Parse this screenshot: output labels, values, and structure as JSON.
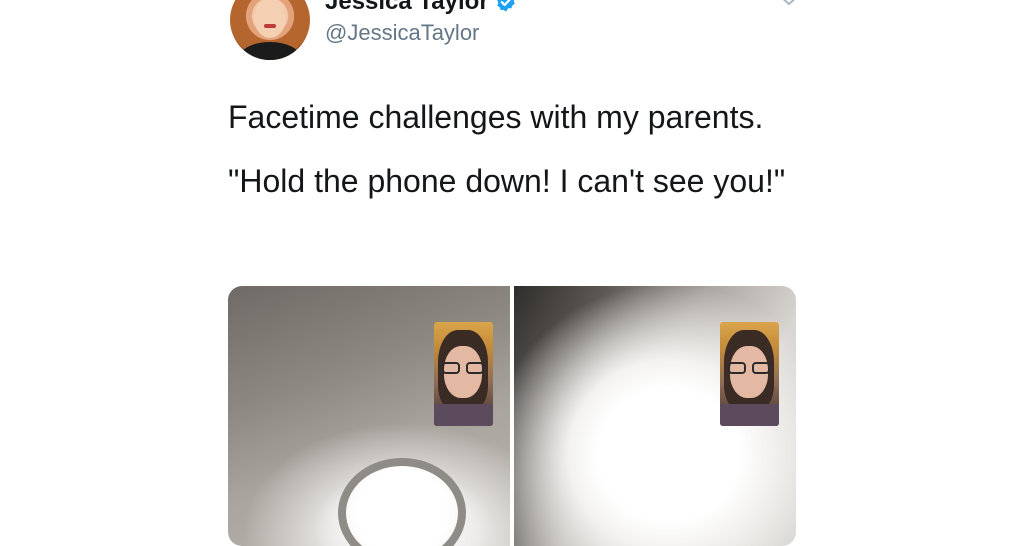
{
  "tweet": {
    "author": {
      "display_name": "Jessica Taylor",
      "handle": "@JessicaTaylor",
      "verified": true,
      "avatar_icon": "profile-photo",
      "verified_icon": "verified-badge-icon",
      "verified_color": "#1da1f2"
    },
    "menu_icon": "chevron-down-icon",
    "text_lines": [
      "Facetime challenges with my parents.",
      "\"Hold the phone down! I can't see you!\""
    ],
    "media": [
      {
        "name": "facetime-screenshot-1",
        "description_icon": "ceiling-light-photo"
      },
      {
        "name": "facetime-screenshot-2",
        "description_icon": "ceiling-light-photo"
      }
    ]
  },
  "colors": {
    "text_primary": "#14171a",
    "text_secondary": "#657786",
    "background": "#ffffff"
  }
}
